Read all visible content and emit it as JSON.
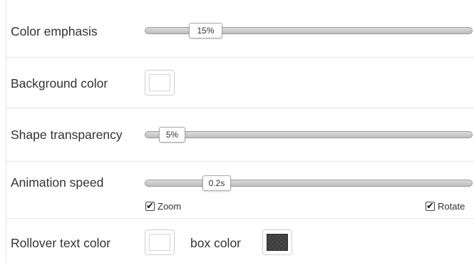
{
  "settings": {
    "color_emphasis": {
      "label": "Color emphasis",
      "value": "15%",
      "fraction": 0.15
    },
    "background_color": {
      "label": "Background color",
      "color": "#ffffff"
    },
    "shape_transparency": {
      "label": "Shape transparency",
      "value": "5%",
      "fraction": 0.05
    },
    "animation_speed": {
      "label": "Animation speed",
      "value": "0.2s",
      "zoom_label": "Zoom",
      "zoom_checked": true,
      "rotate_label": "Rotate",
      "rotate_checked": true
    },
    "rollover": {
      "text_color_label": "Rollover text color",
      "text_color": "#ffffff",
      "box_color_label": "box color",
      "box_color": "#3a3a3a"
    }
  }
}
